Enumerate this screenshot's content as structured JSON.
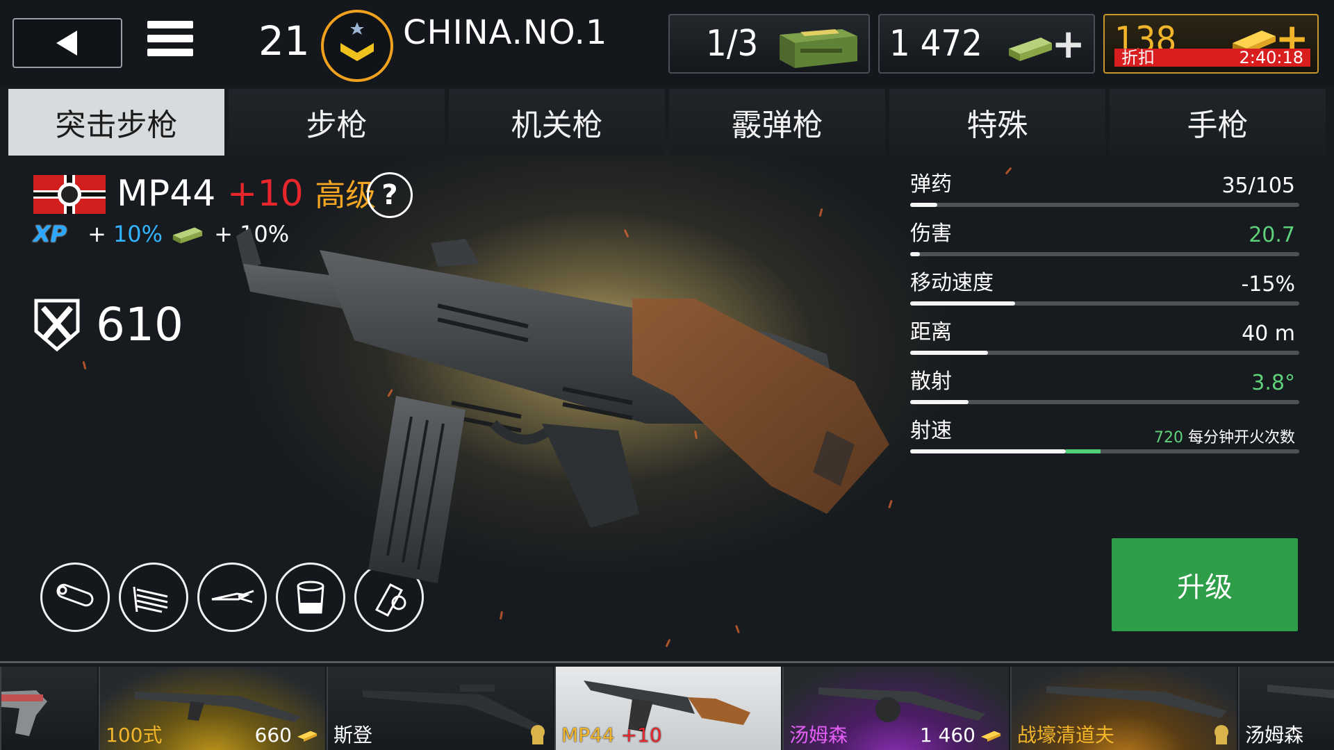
{
  "player": {
    "level": "21",
    "name": "CHINA.NO.1"
  },
  "resources": {
    "crates": "1/3",
    "cash": "1 472",
    "gold": "138",
    "discount_label": "折扣",
    "discount_timer": "2:40:18"
  },
  "tabs": [
    {
      "label": "突击步枪",
      "active": true
    },
    {
      "label": "步枪"
    },
    {
      "label": "机关枪"
    },
    {
      "label": "霰弹枪"
    },
    {
      "label": "特殊"
    },
    {
      "label": "手枪"
    }
  ],
  "weapon": {
    "name": "MP44",
    "level": "+10",
    "tier": "高级",
    "help": "?",
    "xp_tag": "XP",
    "xp_bonus_plus": "+",
    "xp_bonus": "10%",
    "cash_bonus": "+ 10%",
    "power": "610"
  },
  "stats": [
    {
      "label": "弹药",
      "value": "35/105",
      "fill": 0.07
    },
    {
      "label": "伤害",
      "value": "20.7",
      "fill": 0.025,
      "green": true
    },
    {
      "label": "移动速度",
      "value": "-15%",
      "fill": 0.27
    },
    {
      "label": "距离",
      "value": "40 m",
      "fill": 0.2
    },
    {
      "label": "散射",
      "value": "3.8°",
      "fill": 0.15,
      "green": true
    },
    {
      "label": "射速",
      "value_num": "720",
      "value_unit": "每分钟开火次数",
      "fill": 0.4,
      "bonus": 0.09
    }
  ],
  "upgrade_label": "升级",
  "carousel": [
    {
      "name": ""
    },
    {
      "name": "100式",
      "price": "660",
      "style": "gold"
    },
    {
      "name": "斯登",
      "locked": true
    },
    {
      "name": "MP44",
      "level": "+10",
      "selected": true
    },
    {
      "name": "汤姆森",
      "price": "1 460",
      "style": "purple"
    },
    {
      "name": "战壕清道夫",
      "locked": true,
      "style": "amber"
    },
    {
      "name": "汤姆森"
    }
  ],
  "colors": {
    "accent_gold": "#f2b52a",
    "level_red": "#e8262c",
    "upgrade_green": "#2e9e48",
    "stat_green": "#5fd17a"
  }
}
